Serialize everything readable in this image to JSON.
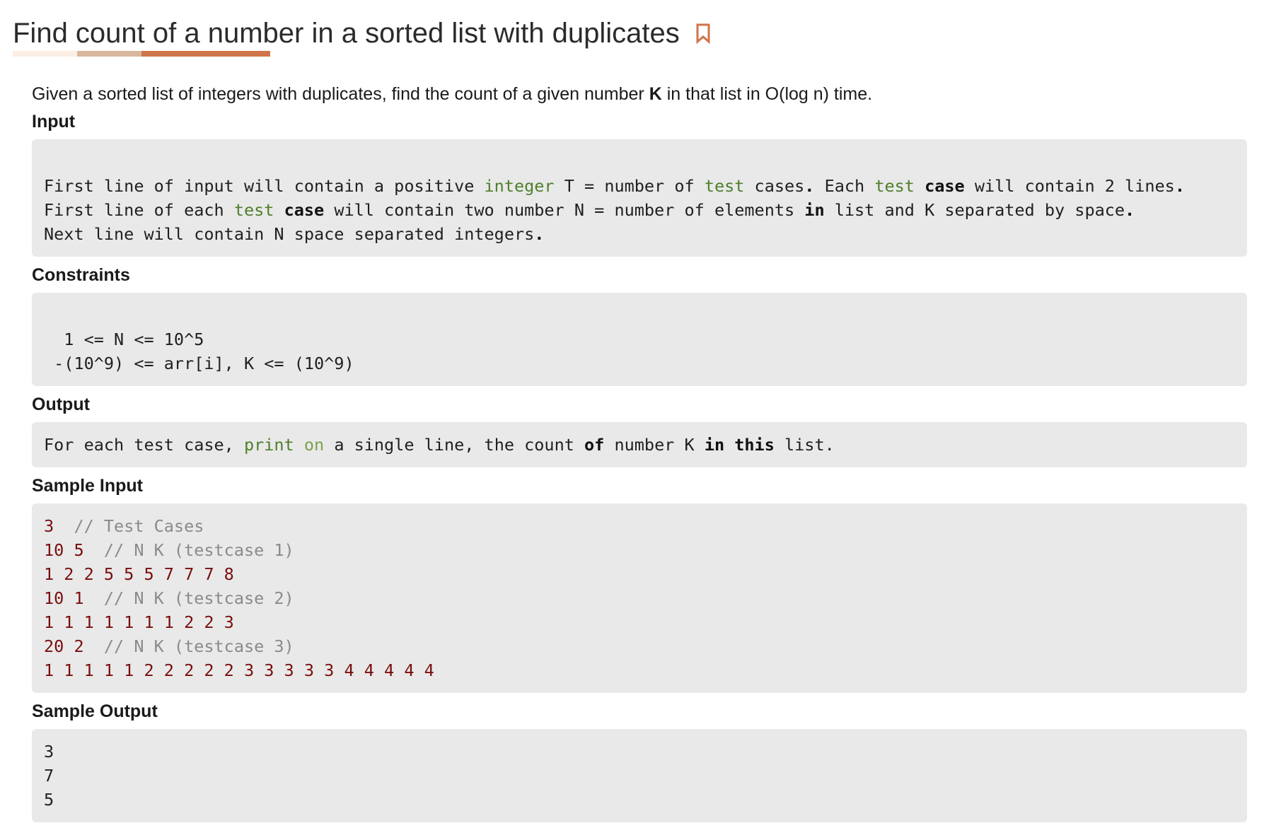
{
  "title": "Find count of a number in a sorted list with duplicates",
  "bookmark_icon": "bookmark-icon",
  "accent_color": "#d0744a",
  "description": {
    "before": "Given a sorted list of integers with duplicates, find the count of a given number ",
    "bold": "K",
    "after": " in that list in O(log n) time."
  },
  "sections": {
    "input": {
      "heading": "Input",
      "lines": [
        "First line of input will contain a positive integer T = number of test cases. Each test case will contain 2 lines.",
        "First line of each test case will contain two number N = number of elements in list and K separated by space.",
        "Next line will contain N space separated integers."
      ]
    },
    "constraints": {
      "heading": "Constraints",
      "lines": [
        "  1 <= N <= 10^5",
        " -(10^9) <= arr[i], K <= (10^9)"
      ]
    },
    "output": {
      "heading": "Output",
      "lines": [
        "For each test case, print on a single line, the count of number K in this list."
      ]
    },
    "sample_input": {
      "heading": "Sample Input",
      "lines": [
        {
          "code": "3",
          "comment": "// Test Cases",
          "gap": "  "
        },
        {
          "code": "10 5",
          "comment": "// N K (testcase 1)",
          "gap": "  "
        },
        {
          "code": "1 2 2 5 5 5 7 7 7 8",
          "comment": "",
          "gap": ""
        },
        {
          "code": "10 1",
          "comment": "// N K (testcase 2)",
          "gap": "  "
        },
        {
          "code": "1 1 1 1 1 1 1 2 2 3",
          "comment": "",
          "gap": ""
        },
        {
          "code": "20 2",
          "comment": "// N K (testcase 3)",
          "gap": "  "
        },
        {
          "code": "1 1 1 1 1 2 2 2 2 2 3 3 3 3 3 4 4 4 4 4",
          "comment": "",
          "gap": ""
        }
      ]
    },
    "sample_output": {
      "heading": "Sample Output",
      "lines": [
        "3",
        "7",
        "5"
      ]
    }
  }
}
